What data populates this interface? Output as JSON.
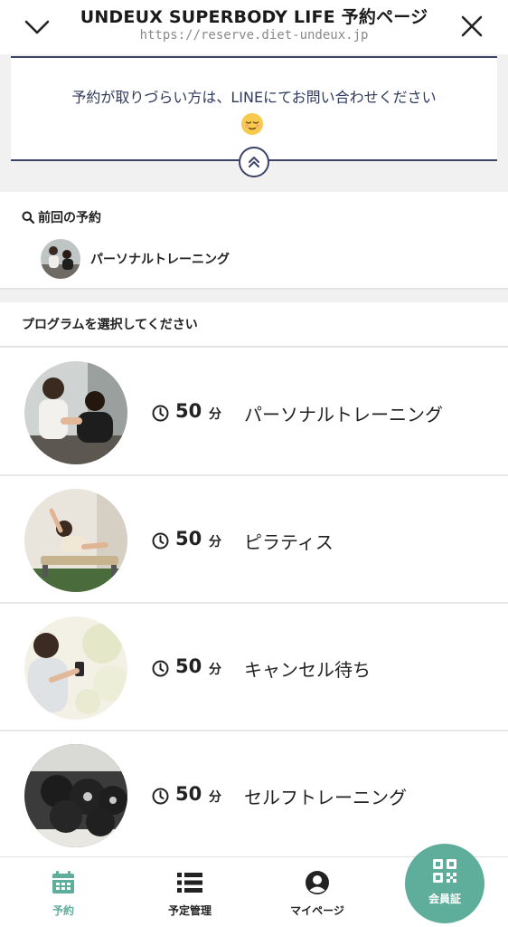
{
  "browser": {
    "title": "UNDEUX SUPERBODY LIFE 予約ページ",
    "url": "https://reserve.diet-undeux.jp",
    "icons": {
      "back": "chevron-down-icon",
      "close": "close-icon"
    }
  },
  "notice": {
    "message": "予約が取りづらい方は、LINEにてお問い合わせください",
    "emoji_icon": "relieved-face-emoji",
    "toggle_icon": "double-chevron-up-icon",
    "border_color": "#3b4466"
  },
  "previous": {
    "heading": "前回の予約",
    "icon": "search-icon",
    "program": "パーソナルトレーニング"
  },
  "programs_heading": "プログラムを選択してください",
  "programs": [
    {
      "duration": "50",
      "unit": "分",
      "name": "パーソナルトレーニング",
      "photo": "personal-training-photo"
    },
    {
      "duration": "50",
      "unit": "分",
      "name": "ピラティス",
      "photo": "pilates-photo"
    },
    {
      "duration": "50",
      "unit": "分",
      "name": "キャンセル待ち",
      "photo": "cancel-waitlist-photo"
    },
    {
      "duration": "50",
      "unit": "分",
      "name": "セルフトレーニング",
      "photo": "self-training-photo"
    }
  ],
  "nav": {
    "items": [
      {
        "label": "予約",
        "icon": "calendar-icon",
        "active": true
      },
      {
        "label": "予定管理",
        "icon": "list-icon",
        "active": false
      },
      {
        "label": "マイページ",
        "icon": "user-circle-icon",
        "active": false
      }
    ],
    "member": {
      "label": "会員証",
      "icon": "qr-code-icon"
    },
    "accent_color": "#5fae9c"
  }
}
